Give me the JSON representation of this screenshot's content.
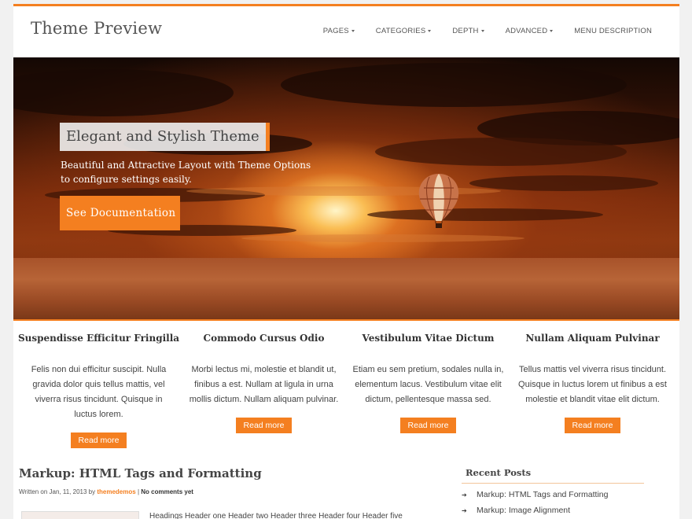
{
  "site": {
    "title": "Theme Preview"
  },
  "nav": [
    {
      "label": "PAGES"
    },
    {
      "label": "CATEGORIES"
    },
    {
      "label": "DEPTH"
    },
    {
      "label": "ADVANCED"
    },
    {
      "label": "MENU DESCRIPTION"
    }
  ],
  "hero": {
    "title": "Elegant and Stylish Theme",
    "description": "Beautiful and Attractive Layout with Theme Options to configure settings easily.",
    "button_label": "See Documentation"
  },
  "features": [
    {
      "title": "Suspendisse Efficitur Fringilla",
      "text": "Felis non dui efficitur suscipit. Nulla gravida dolor quis tellus mattis, vel viverra risus tincidunt. Quisque in luctus lorem.",
      "button_label": "Read more"
    },
    {
      "title": "Commodo Cursus Odio",
      "text": "Morbi lectus mi, molestie et blandit ut, finibus a est. Nullam at ligula in urna mollis dictum. Nullam aliquam pulvinar.",
      "button_label": "Read more"
    },
    {
      "title": "Vestibulum Vitae Dictum",
      "text": "Etiam eu sem pretium, sodales nulla in, elementum lacus. Vestibulum vitae elit dictum, pellentesque massa sed.",
      "button_label": "Read more"
    },
    {
      "title": "Nullam Aliquam Pulvinar",
      "text": "Tellus mattis vel viverra risus tincidunt. Quisque in luctus lorem ut finibus a est molestie et blandit vitae elit dictum.",
      "button_label": "Read more"
    }
  ],
  "post": {
    "title": "Markup: HTML Tags and Formatting",
    "meta_prefix": "Written on Jan, 11, 2013 by",
    "author": "themedemos",
    "separator": "|",
    "comments": "No comments yet",
    "excerpt": "Headings Header one Header two Header three Header four Header five"
  },
  "sidebar": {
    "title": "Recent Posts",
    "items": [
      {
        "label": "Markup: HTML Tags and Formatting"
      },
      {
        "label": "Markup: Image Alignment"
      }
    ]
  },
  "colors": {
    "accent": "#f47f20"
  }
}
